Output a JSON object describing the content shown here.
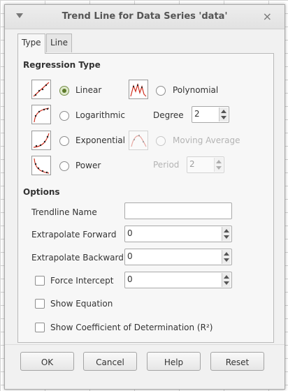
{
  "dialog": {
    "title": "Trend Line for Data Series 'data'",
    "close_glyph": "×"
  },
  "tabs": [
    {
      "label": "Type"
    },
    {
      "label": "Line"
    }
  ],
  "regression": {
    "title": "Regression Type",
    "linear": "Linear",
    "logarithmic": "Logarithmic",
    "exponential": "Exponential",
    "power": "Power",
    "polynomial": "Polynomial",
    "degree_label": "Degree",
    "degree_value": "2",
    "moving_average": "Moving Average",
    "period_label": "Period",
    "period_value": "2",
    "selected": "linear"
  },
  "options": {
    "title": "Options",
    "trendline_name_label": "Trendline Name",
    "trendline_name_value": "",
    "extrapolate_forward_label": "Extrapolate Forward",
    "extrapolate_forward_value": "0",
    "extrapolate_backward_label": "Extrapolate Backward",
    "extrapolate_backward_value": "0",
    "force_intercept_label": "Force Intercept",
    "force_intercept_value": "0",
    "show_equation_label": "Show Equation",
    "show_r2_label": "Show Coefficient of Determination (R²)"
  },
  "buttons": {
    "ok": "OK",
    "cancel": "Cancel",
    "help": "Help",
    "reset": "Reset"
  },
  "icons": {
    "window_menu": "triangle-down-icon",
    "close": "close-icon",
    "linear": "linear-trend-icon",
    "logarithmic": "logarithmic-trend-icon",
    "exponential": "exponential-trend-icon",
    "power": "power-trend-icon",
    "polynomial": "polynomial-trend-icon",
    "moving_average": "moving-average-trend-icon"
  },
  "colors": {
    "accent_radio": "#5c7a2a",
    "trend_red": "#d03020"
  }
}
